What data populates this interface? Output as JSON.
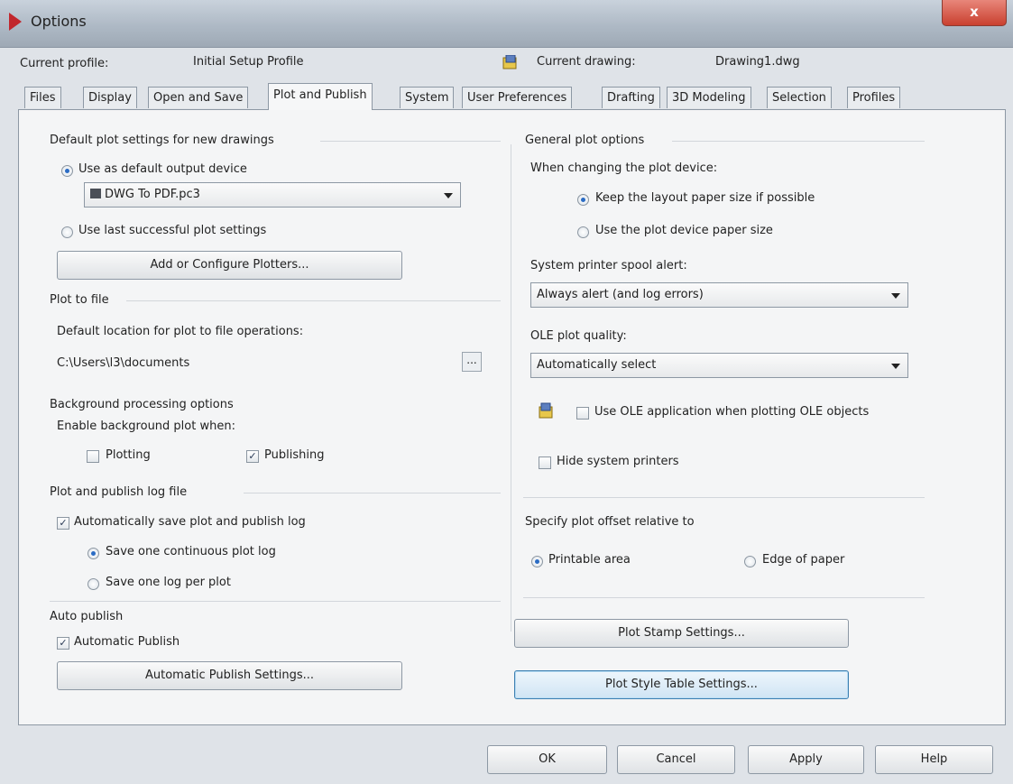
{
  "window": {
    "title": "Options",
    "close_label": "x"
  },
  "profile": {
    "current_profile_label": "Current profile:",
    "current_profile_value": "Initial Setup Profile",
    "current_drawing_label": "Current drawing:",
    "current_drawing_value": "Drawing1.dwg"
  },
  "tabs": [
    {
      "label": "Files"
    },
    {
      "label": "Display"
    },
    {
      "label": "Open and Save"
    },
    {
      "label": "Plot and Publish"
    },
    {
      "label": "System"
    },
    {
      "label": "User Preferences"
    },
    {
      "label": "Drafting"
    },
    {
      "label": "3D Modeling"
    },
    {
      "label": "Selection"
    },
    {
      "label": "Profiles"
    }
  ],
  "left": {
    "default_plot": {
      "title": "Default plot settings for new drawings",
      "use_default_label": "Use as default output device",
      "device_value": "DWG To PDF.pc3",
      "use_last_label": "Use last successful plot settings",
      "add_plotters_button": "Add or Configure Plotters..."
    },
    "plot_to_file": {
      "title": "Plot to file",
      "location_label": "Default location for plot to file operations:",
      "path_value": "C:\\Users\\l3\\documents",
      "browse_label": "..."
    },
    "background": {
      "title": "Background processing options",
      "enable_label": "Enable background plot when:",
      "plotting_label": "Plotting",
      "publishing_label": "Publishing"
    },
    "log": {
      "title": "Plot and publish log file",
      "auto_save_label": "Automatically save plot and publish log",
      "continuous_label": "Save one continuous plot log",
      "per_plot_label": "Save one log per plot"
    },
    "auto_publish": {
      "title": "Auto publish",
      "automatic_label": "Automatic Publish",
      "settings_button": "Automatic Publish Settings..."
    }
  },
  "right": {
    "general": {
      "title": "General plot options",
      "changing_label": "When changing the plot device:",
      "keep_layout_label": "Keep the layout paper size if possible",
      "use_device_label": "Use the plot device paper size",
      "spool_label": "System printer spool alert:",
      "spool_value": "Always alert (and log errors)",
      "ole_quality_label": "OLE plot quality:",
      "ole_quality_value": "Automatically select",
      "use_ole_label": "Use OLE application when plotting OLE objects",
      "hide_printers_label": "Hide system printers"
    },
    "offset": {
      "title": "Specify plot offset relative to",
      "printable_label": "Printable area",
      "edge_label": "Edge of paper"
    },
    "stamp_button": "Plot Stamp Settings...",
    "style_table_button": "Plot Style Table Settings..."
  },
  "footer": {
    "ok": "OK",
    "cancel": "Cancel",
    "apply": "Apply",
    "help": "Help"
  },
  "checks": {
    "mark": "✓"
  }
}
